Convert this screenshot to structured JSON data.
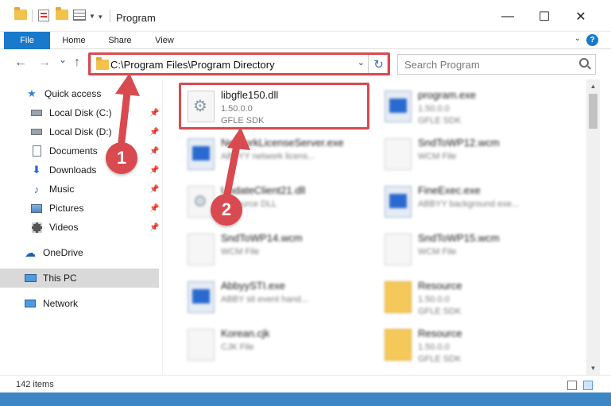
{
  "window": {
    "title": "Program",
    "minimize": "—",
    "maximize": "☐",
    "close": "✕"
  },
  "ribbon": {
    "tabs": [
      "File",
      "Home",
      "Share",
      "View"
    ],
    "help": "?"
  },
  "nav": {
    "back": "←",
    "forward": "→",
    "history": "⌄",
    "up": "↑",
    "address": "C:\\Program Files\\Program Directory",
    "refresh": "↻",
    "search_placeholder": "Search Program"
  },
  "sidebar": {
    "items": [
      {
        "label": "Quick access",
        "icon": "star-icon",
        "pinned": false
      },
      {
        "label": "Local Disk (C:)",
        "icon": "drive-icon",
        "pinned": true
      },
      {
        "label": "Local Disk (D:)",
        "icon": "drive-icon",
        "pinned": true
      },
      {
        "label": "Documents",
        "icon": "documents-icon",
        "pinned": true
      },
      {
        "label": "Downloads",
        "icon": "download-icon",
        "pinned": true
      },
      {
        "label": "Music",
        "icon": "music-icon",
        "pinned": true
      },
      {
        "label": "Pictures",
        "icon": "pictures-icon",
        "pinned": true
      },
      {
        "label": "Videos",
        "icon": "videos-icon",
        "pinned": true
      },
      {
        "label": "OneDrive",
        "icon": "cloud-icon",
        "pinned": false
      },
      {
        "label": "This PC",
        "icon": "computer-icon",
        "pinned": false
      },
      {
        "label": "Network",
        "icon": "network-icon",
        "pinned": false
      }
    ]
  },
  "files": [
    {
      "name": "libgfle150.dll",
      "line1": "1.50.0.0",
      "line2": "GFLE SDK",
      "type": "gear"
    },
    {
      "name": "program.exe",
      "line1": "1.50.0.0",
      "line2": "GFLE SDK",
      "type": "exe"
    },
    {
      "name": "NetworkLicenseServer.exe",
      "line1": "ABBYY network licens...",
      "line2": "",
      "type": "exe"
    },
    {
      "name": "SndToWP12.wcm",
      "line1": "WCM File",
      "line2": "",
      "type": "doc"
    },
    {
      "name": "UpdateClient21.dll",
      "line1": "Resource DLL",
      "line2": "",
      "type": "gear"
    },
    {
      "name": "FineExec.exe",
      "line1": "ABBYY background exe...",
      "line2": "",
      "type": "exe"
    },
    {
      "name": "SndToWP14.wcm",
      "line1": "WCM File",
      "line2": "",
      "type": "doc"
    },
    {
      "name": "SndToWP15.wcm",
      "line1": "WCM File",
      "line2": "",
      "type": "doc"
    },
    {
      "name": "AbbyySTI.exe",
      "line1": "ABBY sti event hand...",
      "line2": "",
      "type": "exe"
    },
    {
      "name": "Resource",
      "line1": "1.50.0.0",
      "line2": "GFLE SDK",
      "type": "folder"
    },
    {
      "name": "Korean.cjk",
      "line1": "CJK File",
      "line2": "",
      "type": "doc"
    },
    {
      "name": "Resource",
      "line1": "1.50.0.0",
      "line2": "GFLE SDK",
      "type": "folder"
    }
  ],
  "markers": [
    "1",
    "2"
  ],
  "status": {
    "count": "142 items"
  },
  "colors": {
    "accent": "#1979ca",
    "highlight": "#d84a4f"
  }
}
